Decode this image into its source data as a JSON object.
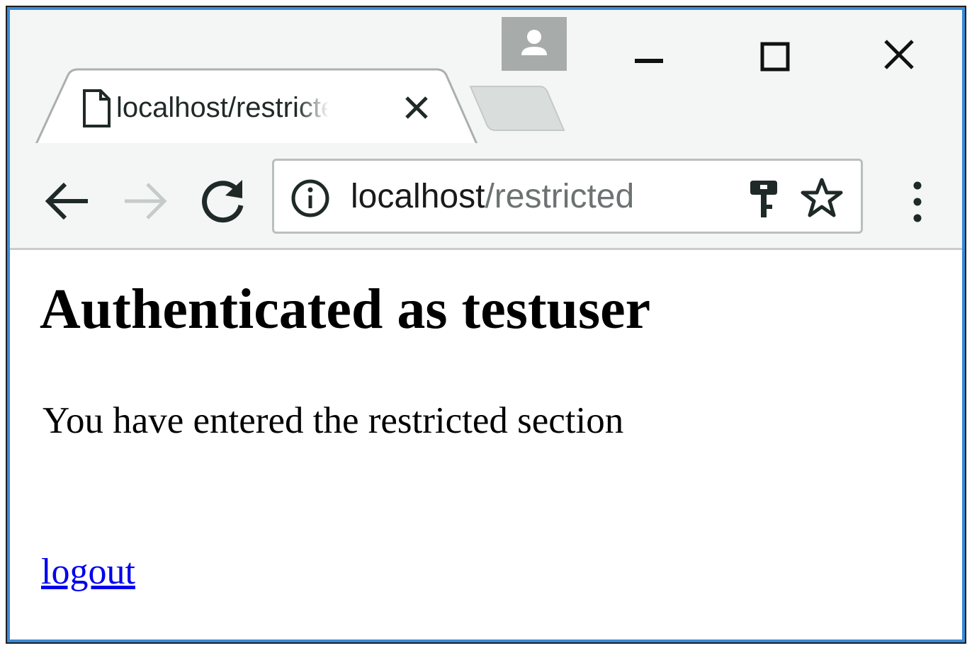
{
  "browser": {
    "tab": {
      "title": "localhost/restricted"
    },
    "address_bar": {
      "host": "localhost",
      "path": "/restricted"
    }
  },
  "page": {
    "heading": "Authenticated as testuser",
    "message": "You have entered the restricted section",
    "logout_link": "logout"
  },
  "icons": {
    "profile": "profile-icon",
    "minimize": "minimize-icon",
    "maximize": "maximize-icon",
    "close_window": "close-icon",
    "tab_page": "document-icon",
    "tab_close": "close-icon",
    "back": "back-arrow-icon",
    "forward": "forward-arrow-icon",
    "reload": "reload-icon",
    "site_info": "info-icon",
    "saved_password": "key-icon",
    "bookmark": "star-icon",
    "menu": "more-vert-icon"
  },
  "colors": {
    "window_border": "#3a8ad6",
    "chrome_background": "#f4f6f5",
    "link": "#0000ee"
  }
}
